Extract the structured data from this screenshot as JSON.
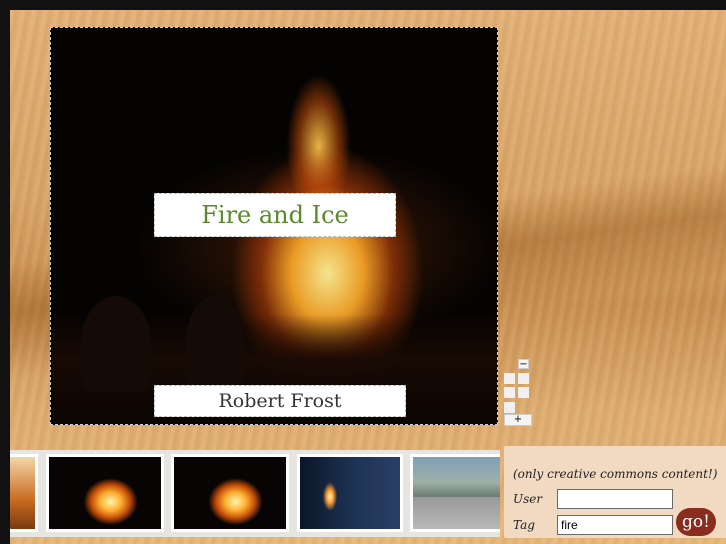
{
  "book": {
    "title": "Fire and Ice",
    "author": "Robert Frost"
  },
  "zoom": {
    "minus_label": "−",
    "plus_label": "+"
  },
  "thumbnails": [
    {
      "name": "partial-image"
    },
    {
      "name": "bonfire-1"
    },
    {
      "name": "bonfire-2"
    },
    {
      "name": "candle-hand"
    },
    {
      "name": "street-cars"
    }
  ],
  "search": {
    "note": "(only creative commons content!)",
    "user_label": "User",
    "user_value": "",
    "tag_label": "Tag",
    "tag_value": "fire",
    "go_label": "go!"
  },
  "colors": {
    "title_text": "#5a8a2a",
    "go_button": "#8a2d1e",
    "panel_bg": "#f1d9c2"
  }
}
